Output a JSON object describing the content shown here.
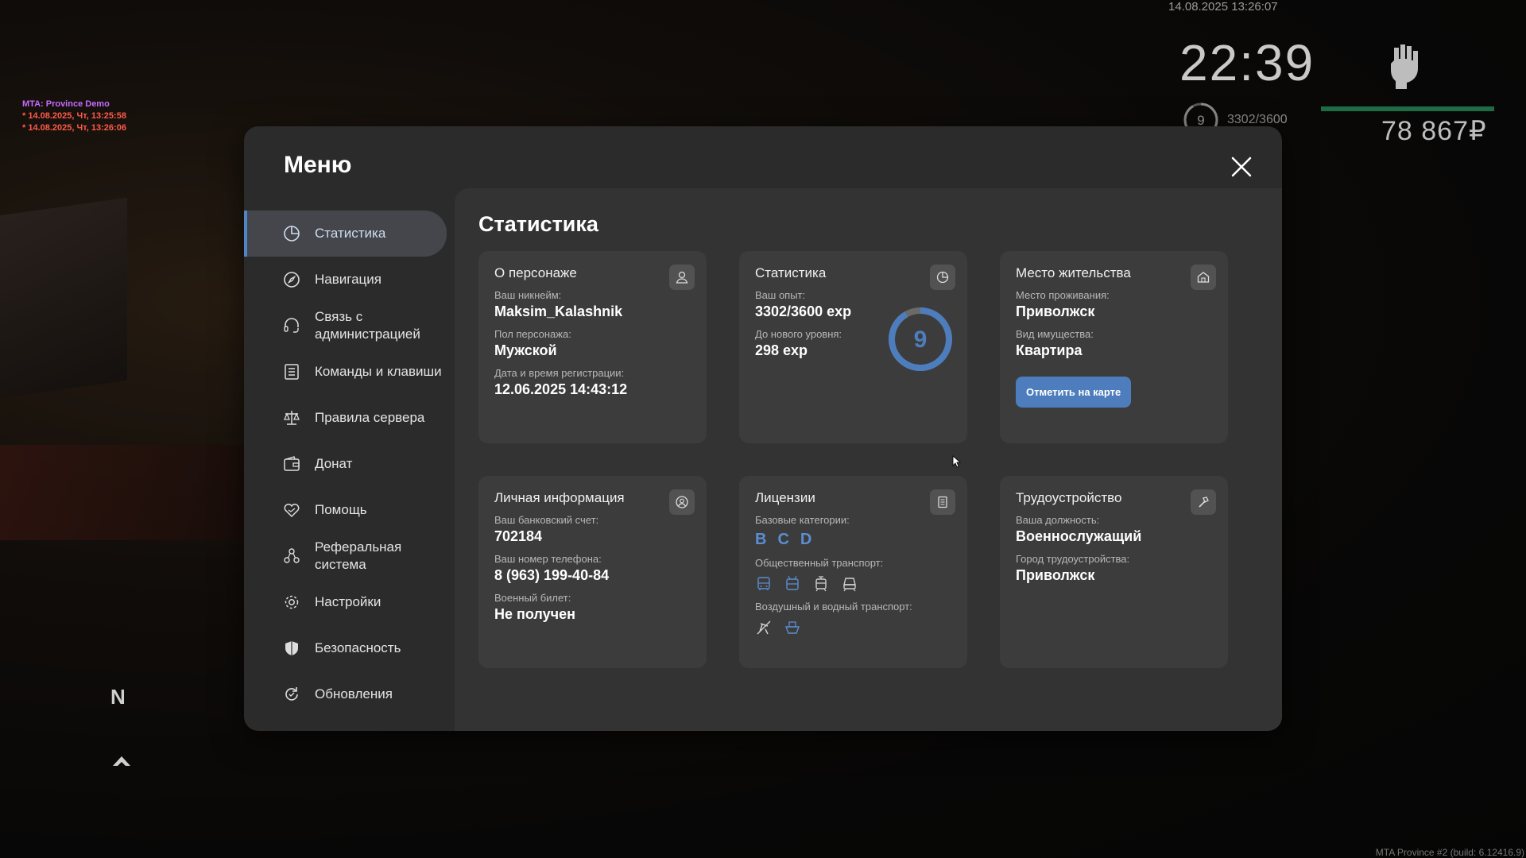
{
  "hud": {
    "datetime": "14.08.2025 13:26:07",
    "clock": "22:39",
    "level": "9",
    "exp": "3302/3600",
    "money": "78 867₽"
  },
  "mta_log": {
    "title": "MTA: Province Demo",
    "line1": "* 14.08.2025, Чт, 13:25:58",
    "line2": "* 14.08.2025, Чт, 13:26:06"
  },
  "compass": "N",
  "build": "MTA Province #2 (build: 6.12416.9)",
  "menu": {
    "title": "Меню",
    "items": [
      {
        "label": "Статистика",
        "icon": "pie-chart-icon"
      },
      {
        "label": "Навигация",
        "icon": "compass-icon"
      },
      {
        "label": "Связь с администрацией",
        "icon": "headset-icon"
      },
      {
        "label": "Команды и клавиши",
        "icon": "list-icon"
      },
      {
        "label": "Правила сервера",
        "icon": "scales-icon"
      },
      {
        "label": "Донат",
        "icon": "wallet-icon"
      },
      {
        "label": "Помощь",
        "icon": "heart-hand-icon"
      },
      {
        "label": "Реферальная система",
        "icon": "people-icon"
      },
      {
        "label": "Настройки",
        "icon": "gear-icon"
      },
      {
        "label": "Безопасность",
        "icon": "shield-icon"
      },
      {
        "label": "Обновления",
        "icon": "refresh-icon"
      }
    ]
  },
  "stats": {
    "title": "Статистика",
    "character": {
      "title": "О персонаже",
      "nick_label": "Ваш никнейм:",
      "nick": "Maksim_Kalashnik",
      "gender_label": "Пол персонажа:",
      "gender": "Мужской",
      "reg_label": "Дата и время регистрации:",
      "reg": "12.06.2025 14:43:12"
    },
    "experience": {
      "title": "Статистика",
      "exp_label": "Ваш опыт:",
      "exp": "3302/3600 exp",
      "next_label": "До нового уровня:",
      "next": "298 exp",
      "level": "9",
      "progress": 0.917
    },
    "residence": {
      "title": "Место жительства",
      "place_label": "Место проживания:",
      "place": "Приволжск",
      "type_label": "Вид имущества:",
      "type": "Квартира",
      "button": "Отметить на карте"
    },
    "personal": {
      "title": "Личная информация",
      "bank_label": "Ваш банковский счет:",
      "bank": "702184",
      "phone_label": "Ваш номер телефона:",
      "phone": "8 (963) 199-40-84",
      "military_label": "Военный билет:",
      "military": "Не получен"
    },
    "licenses": {
      "title": "Лицензии",
      "base_label": "Базовые категории:",
      "cat1": "B",
      "cat2": "C",
      "cat3": "D",
      "public_label": "Общественный транспорт:",
      "air_label": "Воздушный и водный транспорт:"
    },
    "job": {
      "title": "Трудоустройство",
      "position_label": "Ваша должность:",
      "position": "Военнослужащий",
      "city_label": "Город трудоустройства:",
      "city": "Приволжск"
    }
  },
  "colors": {
    "accent": "#4d7dbd",
    "category": "#5b8ed0",
    "hud_bar": "#1f6b46"
  }
}
